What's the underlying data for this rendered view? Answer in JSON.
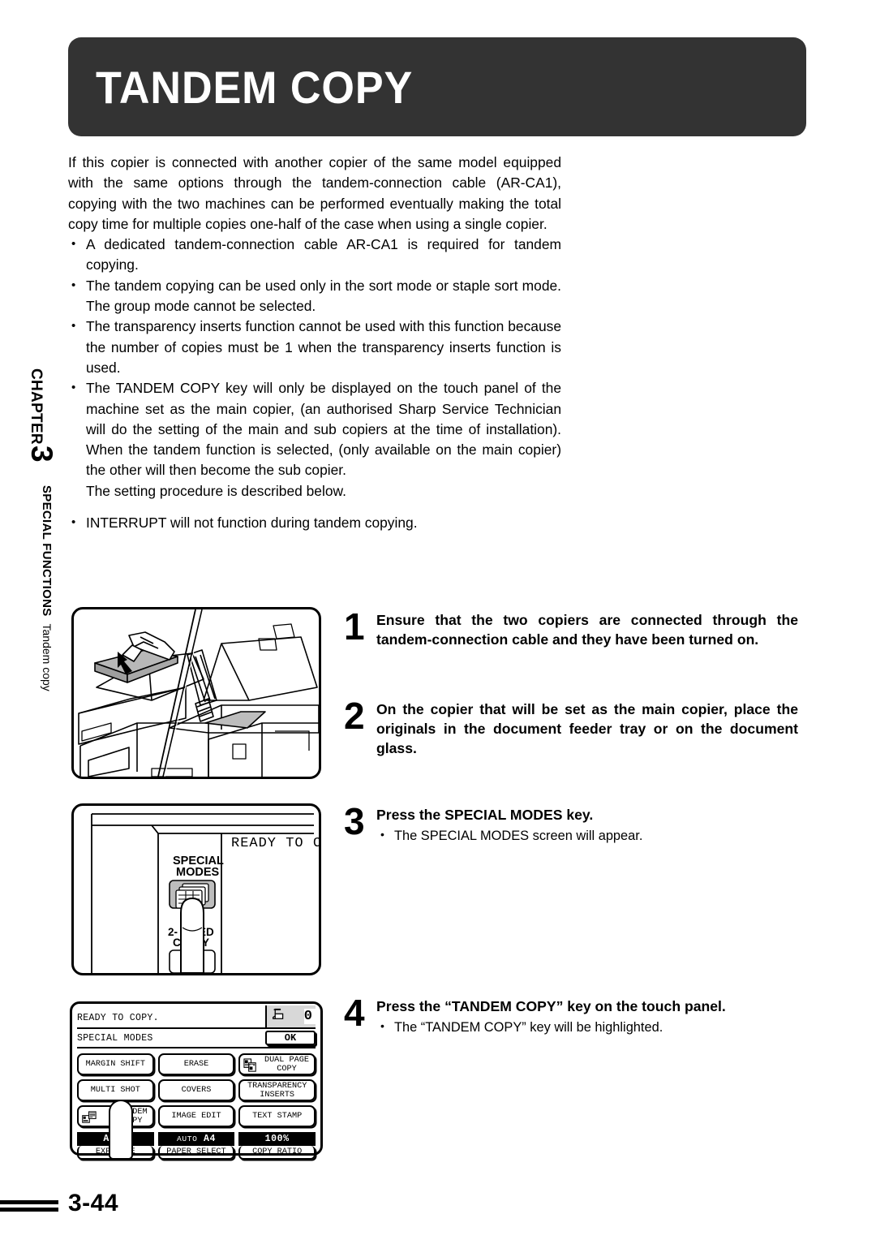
{
  "header": {
    "title": "TANDEM COPY",
    "banner_color": "#333333"
  },
  "sidebar": {
    "chapter_label": "CHAPTER",
    "chapter_number": "3",
    "section_label": "SPECIAL FUNCTIONS",
    "section_sub": "Tandem copy"
  },
  "intro": {
    "paragraph": "If this copier is connected with another copier of the same model equipped with the same options through the tandem-connection cable (AR-CA1), copying with the two machines can be performed eventually making the total copy time for multiple copies one-half of the case when using a single copier.",
    "bullets": [
      "A dedicated tandem-connection cable AR-CA1 is required for tandem copying.",
      "The tandem copying can be used only in the sort mode or staple sort mode. The group mode cannot be selected.",
      "The transparency inserts function cannot be used with this function because the number of copies must be 1 when the transparency inserts function is used.",
      "The TANDEM COPY key will only be displayed on the touch panel of the machine set as the main copier, (an authorised Sharp Service Technician will do the setting of the main and sub copiers at the time of installation). When the tandem function is selected, (only available on the main copier) the other will then become the sub copier."
    ],
    "continuation": "The setting procedure is described below.",
    "last_bullet": "INTERRUPT will not function during tandem copying."
  },
  "steps": [
    {
      "number": "1",
      "heading": "Ensure that the two copiers are connected through the tandem-connection cable and they have been turned on.",
      "sub": ""
    },
    {
      "number": "2",
      "heading": "On the copier that will be set as the main copier, place the originals in the document feeder tray or on the document glass.",
      "sub": ""
    },
    {
      "number": "3",
      "heading": "Press the SPECIAL MODES key.",
      "sub": "The SPECIAL MODES screen will appear."
    },
    {
      "number": "4",
      "heading": "Press the “TANDEM COPY” key on the touch panel.",
      "sub": "The  “TANDEM COPY” key will be highlighted."
    }
  ],
  "illustration_copier": {
    "name": "copier-document-feeder-illustration",
    "description": "Line drawing of a copier with document feeder tray and document glass, originals being placed"
  },
  "illustration_keypad": {
    "name": "special-modes-key-illustration",
    "key_label_line1": "SPECIAL",
    "key_label_line2": "MODES",
    "display_text": "READY TO C",
    "other_key_line1": "2-",
    "other_key_line2": "ED",
    "other_key_line3": "Y"
  },
  "touch_panel": {
    "status_message": "READY TO COPY.",
    "copy_count": "0",
    "printer_icon": "printer-icon",
    "section_title": "SPECIAL MODES",
    "ok_label": "OK",
    "buttons": [
      {
        "label": "MARGIN SHIFT",
        "icon": null
      },
      {
        "label": "ERASE",
        "icon": null
      },
      {
        "label": "DUAL PAGE\nCOPY",
        "icon": "dual-page-icon"
      },
      {
        "label": "MULTI SHOT",
        "icon": null
      },
      {
        "label": "COVERS",
        "icon": null
      },
      {
        "label": "TRANSPARENCY\nINSERTS",
        "icon": null
      },
      {
        "label": "TANDEM\nCOPY",
        "icon": "tandem-copy-icon"
      },
      {
        "label": "IMAGE EDIT",
        "icon": null
      },
      {
        "label": "TEXT STAMP",
        "icon": null
      }
    ],
    "bottom": [
      {
        "value": "AUTO",
        "caption": "EXPOSURE"
      },
      {
        "value": "AUTO A4",
        "caption": "PAPER SELECT"
      },
      {
        "value": "100%",
        "caption": "COPY RATIO"
      }
    ]
  },
  "footer": {
    "page_number": "3-44"
  }
}
